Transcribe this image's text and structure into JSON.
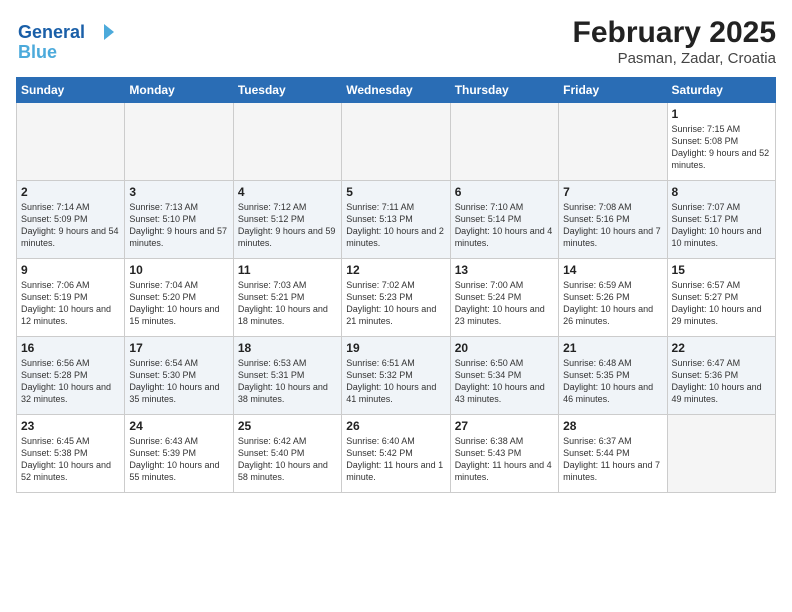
{
  "logo": {
    "line1": "General",
    "line2": "Blue"
  },
  "calendar": {
    "title": "February 2025",
    "subtitle": "Pasman, Zadar, Croatia",
    "headers": [
      "Sunday",
      "Monday",
      "Tuesday",
      "Wednesday",
      "Thursday",
      "Friday",
      "Saturday"
    ],
    "weeks": [
      [
        {
          "day": "",
          "info": ""
        },
        {
          "day": "",
          "info": ""
        },
        {
          "day": "",
          "info": ""
        },
        {
          "day": "",
          "info": ""
        },
        {
          "day": "",
          "info": ""
        },
        {
          "day": "",
          "info": ""
        },
        {
          "day": "1",
          "info": "Sunrise: 7:15 AM\nSunset: 5:08 PM\nDaylight: 9 hours and 52 minutes."
        }
      ],
      [
        {
          "day": "2",
          "info": "Sunrise: 7:14 AM\nSunset: 5:09 PM\nDaylight: 9 hours and 54 minutes."
        },
        {
          "day": "3",
          "info": "Sunrise: 7:13 AM\nSunset: 5:10 PM\nDaylight: 9 hours and 57 minutes."
        },
        {
          "day": "4",
          "info": "Sunrise: 7:12 AM\nSunset: 5:12 PM\nDaylight: 9 hours and 59 minutes."
        },
        {
          "day": "5",
          "info": "Sunrise: 7:11 AM\nSunset: 5:13 PM\nDaylight: 10 hours and 2 minutes."
        },
        {
          "day": "6",
          "info": "Sunrise: 7:10 AM\nSunset: 5:14 PM\nDaylight: 10 hours and 4 minutes."
        },
        {
          "day": "7",
          "info": "Sunrise: 7:08 AM\nSunset: 5:16 PM\nDaylight: 10 hours and 7 minutes."
        },
        {
          "day": "8",
          "info": "Sunrise: 7:07 AM\nSunset: 5:17 PM\nDaylight: 10 hours and 10 minutes."
        }
      ],
      [
        {
          "day": "9",
          "info": "Sunrise: 7:06 AM\nSunset: 5:19 PM\nDaylight: 10 hours and 12 minutes."
        },
        {
          "day": "10",
          "info": "Sunrise: 7:04 AM\nSunset: 5:20 PM\nDaylight: 10 hours and 15 minutes."
        },
        {
          "day": "11",
          "info": "Sunrise: 7:03 AM\nSunset: 5:21 PM\nDaylight: 10 hours and 18 minutes."
        },
        {
          "day": "12",
          "info": "Sunrise: 7:02 AM\nSunset: 5:23 PM\nDaylight: 10 hours and 21 minutes."
        },
        {
          "day": "13",
          "info": "Sunrise: 7:00 AM\nSunset: 5:24 PM\nDaylight: 10 hours and 23 minutes."
        },
        {
          "day": "14",
          "info": "Sunrise: 6:59 AM\nSunset: 5:26 PM\nDaylight: 10 hours and 26 minutes."
        },
        {
          "day": "15",
          "info": "Sunrise: 6:57 AM\nSunset: 5:27 PM\nDaylight: 10 hours and 29 minutes."
        }
      ],
      [
        {
          "day": "16",
          "info": "Sunrise: 6:56 AM\nSunset: 5:28 PM\nDaylight: 10 hours and 32 minutes."
        },
        {
          "day": "17",
          "info": "Sunrise: 6:54 AM\nSunset: 5:30 PM\nDaylight: 10 hours and 35 minutes."
        },
        {
          "day": "18",
          "info": "Sunrise: 6:53 AM\nSunset: 5:31 PM\nDaylight: 10 hours and 38 minutes."
        },
        {
          "day": "19",
          "info": "Sunrise: 6:51 AM\nSunset: 5:32 PM\nDaylight: 10 hours and 41 minutes."
        },
        {
          "day": "20",
          "info": "Sunrise: 6:50 AM\nSunset: 5:34 PM\nDaylight: 10 hours and 43 minutes."
        },
        {
          "day": "21",
          "info": "Sunrise: 6:48 AM\nSunset: 5:35 PM\nDaylight: 10 hours and 46 minutes."
        },
        {
          "day": "22",
          "info": "Sunrise: 6:47 AM\nSunset: 5:36 PM\nDaylight: 10 hours and 49 minutes."
        }
      ],
      [
        {
          "day": "23",
          "info": "Sunrise: 6:45 AM\nSunset: 5:38 PM\nDaylight: 10 hours and 52 minutes."
        },
        {
          "day": "24",
          "info": "Sunrise: 6:43 AM\nSunset: 5:39 PM\nDaylight: 10 hours and 55 minutes."
        },
        {
          "day": "25",
          "info": "Sunrise: 6:42 AM\nSunset: 5:40 PM\nDaylight: 10 hours and 58 minutes."
        },
        {
          "day": "26",
          "info": "Sunrise: 6:40 AM\nSunset: 5:42 PM\nDaylight: 11 hours and 1 minute."
        },
        {
          "day": "27",
          "info": "Sunrise: 6:38 AM\nSunset: 5:43 PM\nDaylight: 11 hours and 4 minutes."
        },
        {
          "day": "28",
          "info": "Sunrise: 6:37 AM\nSunset: 5:44 PM\nDaylight: 11 hours and 7 minutes."
        },
        {
          "day": "",
          "info": ""
        }
      ]
    ]
  }
}
